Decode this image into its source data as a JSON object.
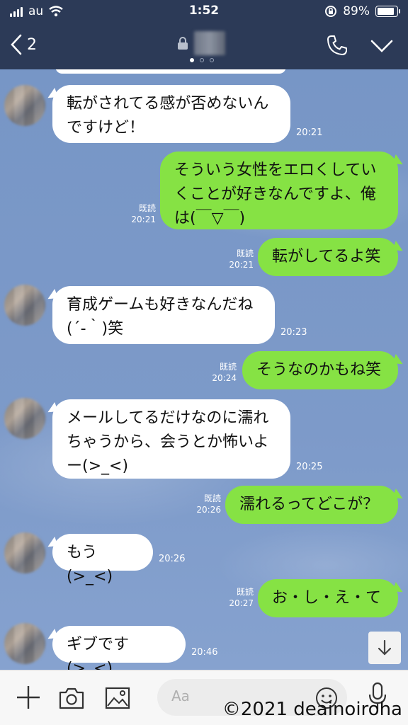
{
  "status_bar": {
    "carrier": "au",
    "time": "1:52",
    "battery_percent": "89%",
    "battery_level": 0.89
  },
  "header": {
    "back_count": "2"
  },
  "messages": [
    {
      "side": "in",
      "lines": [
        "転がされてる感が否めないん",
        "ですけど！"
      ],
      "time": "20:21"
    },
    {
      "side": "out",
      "lines": [
        "そういう女性をエロくしてい",
        "くことが好きなんですよ、俺",
        "は(￣▽￣)"
      ],
      "read": "既読",
      "time": "20:21"
    },
    {
      "side": "out",
      "lines": [
        "転がしてるよ笑"
      ],
      "read": "既読",
      "time": "20:21"
    },
    {
      "side": "in",
      "lines": [
        "育成ゲームも好きなんだね",
        "(´-｀)笑"
      ],
      "time": "20:23"
    },
    {
      "side": "out",
      "lines": [
        "そうなのかもね笑"
      ],
      "read": "既読",
      "time": "20:24"
    },
    {
      "side": "in",
      "lines": [
        "メールしてるだけなのに濡れ",
        "ちゃうから、会うとか怖いよ",
        "ー(>_<)"
      ],
      "time": "20:25"
    },
    {
      "side": "out",
      "lines": [
        "濡れるってどこが？"
      ],
      "read": "既読",
      "time": "20:26"
    },
    {
      "side": "in",
      "lines": [
        "もう(>_<)"
      ],
      "time": "20:26"
    },
    {
      "side": "out",
      "lines": [
        "お・し・え・て"
      ],
      "read": "既読",
      "time": "20:27"
    },
    {
      "side": "in",
      "lines": [
        "ギブです(>_<)"
      ],
      "time": "20:46"
    }
  ],
  "input": {
    "placeholder": "Aa"
  },
  "watermark": "©2021 deainoiroha",
  "colors": {
    "header_bg": "#2c3a57",
    "chat_bg": "#7b97c6",
    "outgoing_bubble": "#86e244",
    "incoming_bubble": "#ffffff"
  },
  "icons": [
    "back-chevron-icon",
    "lock-icon",
    "phone-icon",
    "chevron-down-icon",
    "arrow-down-icon",
    "plus-icon",
    "camera-icon",
    "image-icon",
    "emoji-icon",
    "microphone-icon"
  ]
}
